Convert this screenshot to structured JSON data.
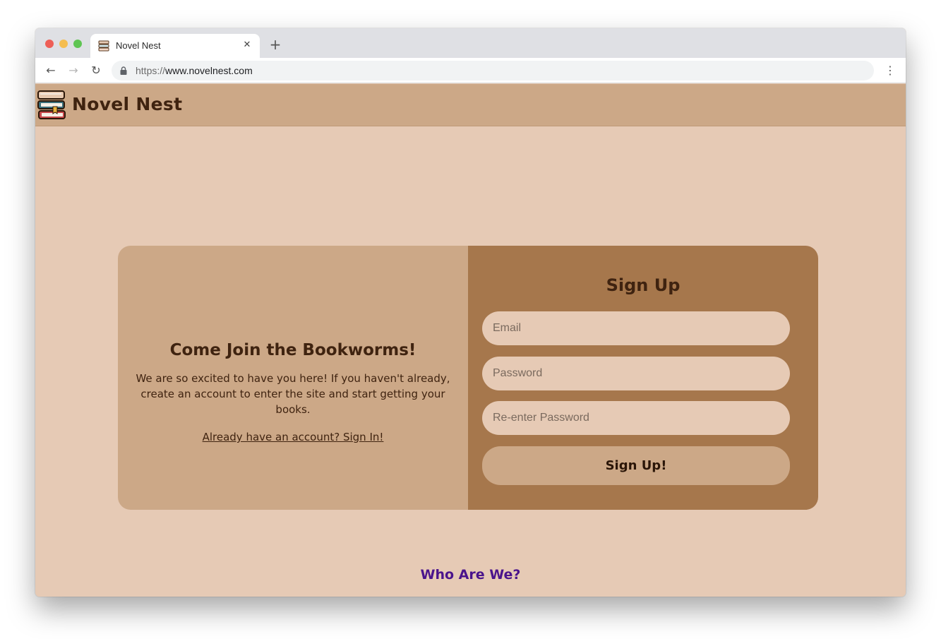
{
  "browser": {
    "tab_title": "Novel Nest",
    "tab_close": "✕",
    "new_tab": "+",
    "url_scheme": "https://",
    "url_host": "www.novelnest.com",
    "back": "←",
    "forward": "→",
    "reload": "↻",
    "menu": "⋮"
  },
  "header": {
    "site_title": "Novel Nest",
    "logo_icon": "book-stack-icon"
  },
  "welcome": {
    "title": "Come Join the Bookworms!",
    "text": "We are so excited to have you here! If you haven't already, create an account to enter the site and start getting your books.",
    "signin_link": "Already have an account? Sign In!"
  },
  "signup": {
    "title": "Sign Up",
    "email_placeholder": "Email",
    "password_placeholder": "Password",
    "repassword_placeholder": "Re-enter Password",
    "button_label": "Sign Up!"
  },
  "footer": {
    "who_link": "Who Are We?"
  },
  "colors": {
    "page_bg": "#e6cab5",
    "header_bg": "#cca887",
    "card_left_bg": "#cca887",
    "card_right_bg": "#a6774c",
    "text_dark": "#3f2310",
    "link_purple": "#4a148c"
  }
}
